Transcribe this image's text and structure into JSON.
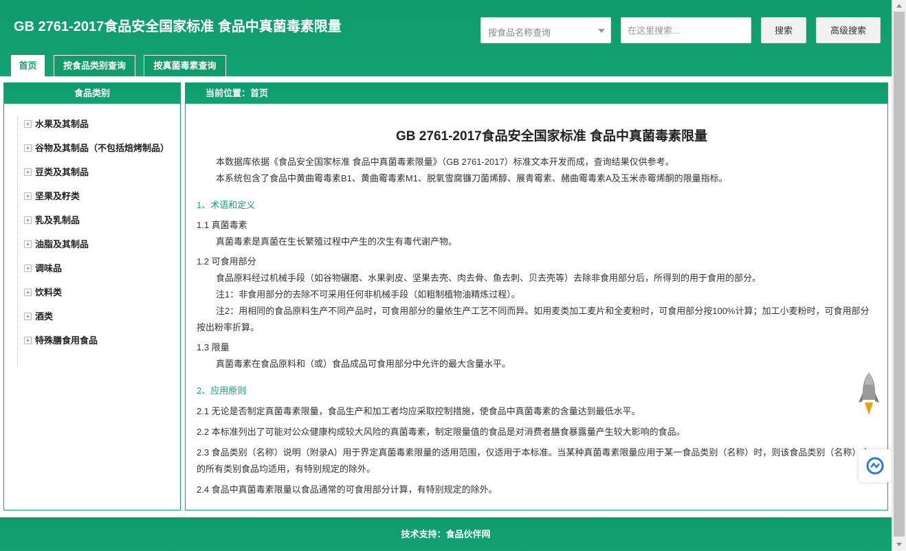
{
  "header": {
    "title": "GB 2761-2017食品安全国家标准 食品中真菌毒素限量",
    "food_select_placeholder": "按食品名称查询",
    "search_placeholder": "在这里搜索...",
    "search_button": "搜索",
    "advanced_search_button": "高级搜索"
  },
  "tabs": [
    {
      "label": "首页"
    },
    {
      "label": "按食品类别查询"
    },
    {
      "label": "按真菌毒素查询"
    }
  ],
  "sidebar": {
    "heading": "食品类别",
    "items": [
      {
        "label": "水果及其制品"
      },
      {
        "label": "谷物及其制品（不包括焙烤制品）"
      },
      {
        "label": "豆类及其制品"
      },
      {
        "label": "坚果及籽类"
      },
      {
        "label": "乳及乳制品"
      },
      {
        "label": "油脂及其制品"
      },
      {
        "label": "调味品"
      },
      {
        "label": "饮料类"
      },
      {
        "label": "酒类"
      },
      {
        "label": "特殊膳食用食品"
      }
    ]
  },
  "main": {
    "breadcrumb": "当前位置：首页",
    "doc_title": "GB 2761-2017食品安全国家标准 食品中真菌毒素限量",
    "intro1": "本数据库依据《食品安全国家标准 食品中真菌毒素限量》（GB 2761-2017）标准文本开发而成，查询结果仅供参考。",
    "intro2": "本系统包含了食品中黄曲霉毒素B1、黄曲霉毒素M1、脱氧雪腐镰刀菌烯醇、展青霉素、赭曲霉毒素A及玉米赤霉烯酮的限量指标。",
    "sec1_title": "1、术语和定义",
    "s11_title": "1.1 真菌毒素",
    "s11_text": "真菌毒素是真菌在生长繁殖过程中产生的次生有毒代谢产物。",
    "s12_title": "1.2 可食用部分",
    "s12_text": "食品原料经过机械手段（如谷物碾磨、水果剥皮、坚果去壳、肉去骨、鱼去刺、贝去壳等）去除非食用部分后，所得到的用于食用的部分。",
    "s12_note1": "注1：非食用部分的去除不可采用任何非机械手段（如粗制植物油精炼过程）。",
    "s12_note2": "注2：用相同的食品原料生产不同产品时，可食用部分的量依生产工艺不同而异。如用麦类加工麦片和全麦粉时，可食用部分按100%计算；加工小麦粉时，可食用部分按出粉率折算。",
    "s13_title": "1.3 限量",
    "s13_text": "真菌毒素在食品原料和（或）食品成品可食用部分中允许的最大含量水平。",
    "sec2_title": "2、应用原则",
    "p21": "2.1 无论是否制定真菌毒素限量，食品生产和加工者均应采取控制措施，使食品中真菌毒素的含量达到最低水平。",
    "p22": "2.2 本标准列出了可能对公众健康构成较大风险的真菌毒素，制定限量值的食品是对消费者膳食暴露量产生较大影响的食品。",
    "p23": "2.3 食品类别（名称）说明（附录A）用于界定真菌毒素限量的适用范围，仅适用于本标准。当某种真菌毒素限量应用于某一食品类别（名称）时，则该食品类别（名称）内的所有类别食品均适用，有特别规定的除外。",
    "p24": "2.4 食品中真菌毒素限量以食品通常的可食用部分计算，有特别规定的除外。"
  },
  "footer": {
    "text": "技术支持：食品伙伴网"
  },
  "colors": {
    "brand_green": "#13a373",
    "rocket_accent": "#f39c12"
  }
}
